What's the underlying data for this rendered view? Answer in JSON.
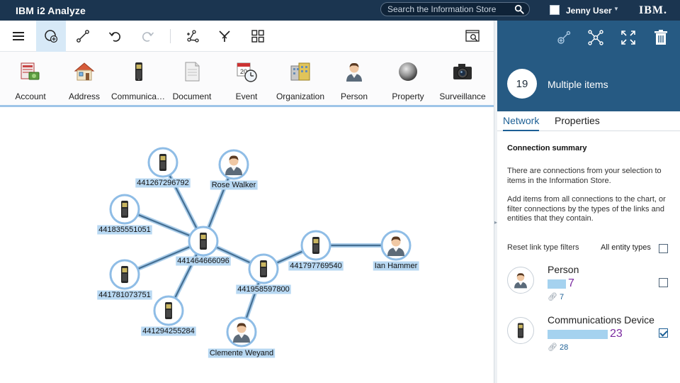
{
  "header": {
    "app_title": "IBM i2 Analyze",
    "search_placeholder": "Search the Information Store",
    "user_name": "Jenny User",
    "brand_logo": "IBM."
  },
  "toolbar": {
    "items": [
      {
        "icon": "menu-icon"
      },
      {
        "icon": "add-item-icon",
        "active": true
      },
      {
        "icon": "add-link-icon"
      },
      {
        "icon": "undo-icon"
      },
      {
        "icon": "redo-icon",
        "disabled": true
      },
      {
        "icon": "expand-icon"
      },
      {
        "icon": "merge-icon"
      },
      {
        "icon": "layout-grid-icon"
      },
      {
        "icon": "find-icon"
      }
    ]
  },
  "palette": {
    "items": [
      {
        "label": "Account",
        "icon": "account-icon"
      },
      {
        "label": "Address",
        "icon": "house-icon"
      },
      {
        "label": "Communications Device",
        "icon": "phone-icon"
      },
      {
        "label": "Document",
        "icon": "document-icon"
      },
      {
        "label": "Event",
        "icon": "calendar-clock-icon"
      },
      {
        "label": "Organization",
        "icon": "organization-icon"
      },
      {
        "label": "Person",
        "icon": "person-icon"
      },
      {
        "label": "Property",
        "icon": "sphere-icon"
      },
      {
        "label": "Surveillance",
        "icon": "camera-icon"
      }
    ]
  },
  "chart": {
    "nodes": [
      {
        "id": "n1",
        "label": "441267296792",
        "type": "phone"
      },
      {
        "id": "n2",
        "label": "Rose Walker",
        "type": "person"
      },
      {
        "id": "n3",
        "label": "441835551051",
        "type": "phone"
      },
      {
        "id": "n4",
        "label": "441464666096",
        "type": "phone"
      },
      {
        "id": "n5",
        "label": "441797769540",
        "type": "phone"
      },
      {
        "id": "n6",
        "label": "Ian Hammer",
        "type": "person"
      },
      {
        "id": "n7",
        "label": "441781073751",
        "type": "phone"
      },
      {
        "id": "n8",
        "label": "441958597800",
        "type": "phone"
      },
      {
        "id": "n9",
        "label": "441294255284",
        "type": "phone"
      },
      {
        "id": "n10",
        "label": "Clemente Weyand",
        "type": "person"
      }
    ],
    "links": [
      [
        "n1",
        "n4"
      ],
      [
        "n2",
        "n4"
      ],
      [
        "n3",
        "n4"
      ],
      [
        "n7",
        "n4"
      ],
      [
        "n9",
        "n4"
      ],
      [
        "n4",
        "n8"
      ],
      [
        "n8",
        "n5"
      ],
      [
        "n5",
        "n6"
      ],
      [
        "n8",
        "n10"
      ]
    ]
  },
  "panel": {
    "tools": [
      {
        "icon": "add-connected-icon"
      },
      {
        "icon": "network-icon"
      },
      {
        "icon": "fit-icon"
      },
      {
        "icon": "trash-icon"
      }
    ],
    "selection_count": "19",
    "selection_title": "Multiple items",
    "tabs": [
      {
        "label": "Network",
        "active": true
      },
      {
        "label": "Properties",
        "active": false
      }
    ],
    "summary_title": "Connection summary",
    "summary_text_1": "There are connections from your selection to items in the Information Store.",
    "summary_text_2": "Add items from all connections to the chart, or filter connections by the types of the links and entities that they contain.",
    "reset_link": "Reset link type filters",
    "all_types_label": "All entity types",
    "all_types_checked": false,
    "entity_types": [
      {
        "name": "Person",
        "count": "7",
        "links": "7",
        "icon": "person-icon",
        "checked": false,
        "value": 7
      },
      {
        "name": "Communications Device",
        "count": "23",
        "links": "28",
        "icon": "phone-icon",
        "checked": true,
        "value": 23
      }
    ]
  }
}
